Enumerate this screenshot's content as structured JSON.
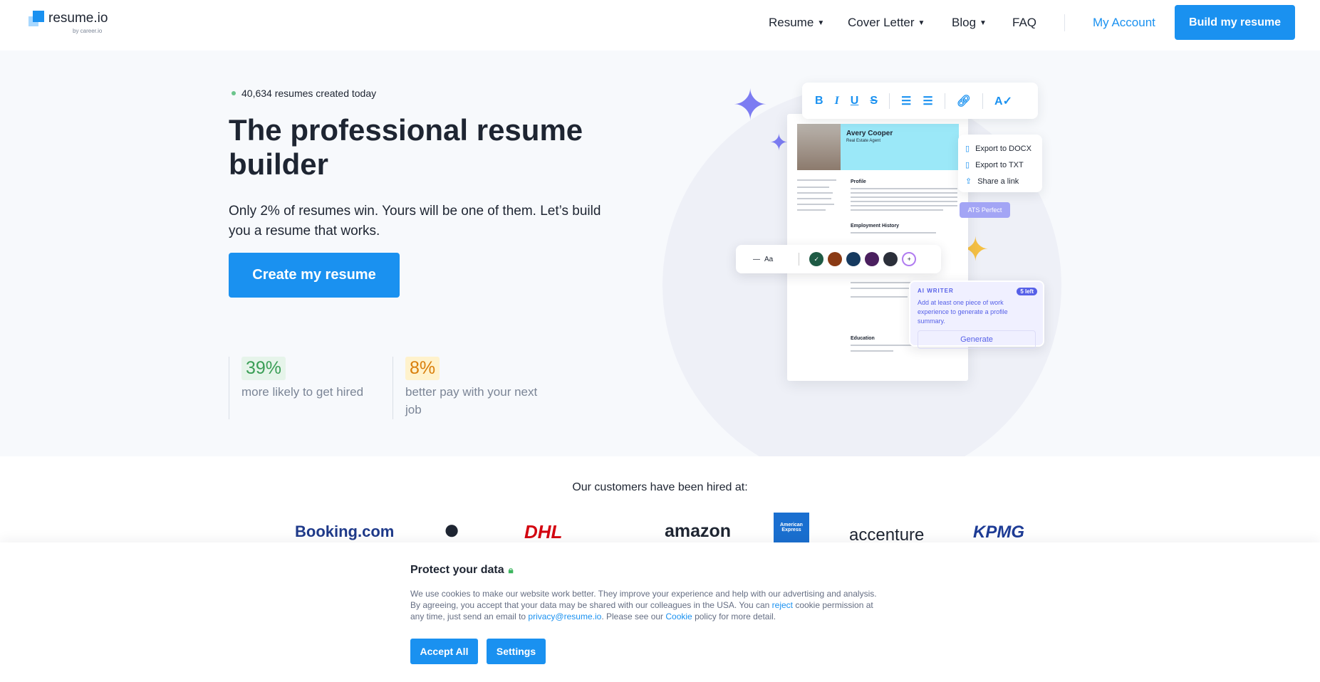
{
  "nav": {
    "logo": "resume.io",
    "logo_sub": "by career.io",
    "items": [
      {
        "label": "Resume"
      },
      {
        "label": "Cover Letter"
      },
      {
        "label": "Blog"
      },
      {
        "label": "FAQ"
      }
    ],
    "my_account": "My Account",
    "build": "Build my resume"
  },
  "hero": {
    "badge": "40,634 resumes created today",
    "title": "The professional resume builder",
    "subtitle": "Only 2% of resumes win. Yours will be one of them. Let’s build you a resume that works.",
    "cta": "Create my resume",
    "stats": [
      {
        "value": "39%",
        "label": "more likely to get hired",
        "color": "#3a9e56",
        "bg": "#e6f4ea"
      },
      {
        "value": "8%",
        "label": "better pay with your next job",
        "color": "#d97e0a",
        "bg": "#fff2cc"
      }
    ]
  },
  "illustration": {
    "name": "Avery Cooper",
    "role": "Real Estate Agent",
    "sections": [
      "Profile",
      "Employment History",
      "Education"
    ],
    "toolbar": [
      "B",
      "I",
      "U",
      "S"
    ],
    "export": [
      "Export to DOCX",
      "Export to TXT",
      "Share a link"
    ],
    "ats": "ATS Perfect",
    "font_label": "Aa",
    "colors": [
      "#1e5a44",
      "#8a3a14",
      "#163a5f",
      "#4a1f5e",
      "#2b2f3a"
    ],
    "ai": {
      "title": "AI WRITER",
      "left": "5 left",
      "message": "Add at least one piece of work experience to generate a profile summary.",
      "button": "Generate"
    }
  },
  "customers": {
    "heading": "Our customers have been hired at:",
    "logos": [
      "Booking.com",
      "Apple",
      "DHL",
      "amazon",
      "American Express",
      "accenture",
      "KPMG"
    ]
  },
  "cookie": {
    "title": "Protect your data",
    "text1": "We use cookies to make our website work better. They improve your experience and help with our advertising and analysis. By agreeing, you accept that your data may be shared with our colleagues in the USA. You can ",
    "reject": "reject",
    "text2": " cookie permission at any time, just send an email to ",
    "email": "privacy@resume.io",
    "text3": ". Please see our ",
    "cookie_link": "Cookie",
    "text4": " policy for more detail.",
    "accept": "Accept All",
    "settings": "Settings"
  }
}
